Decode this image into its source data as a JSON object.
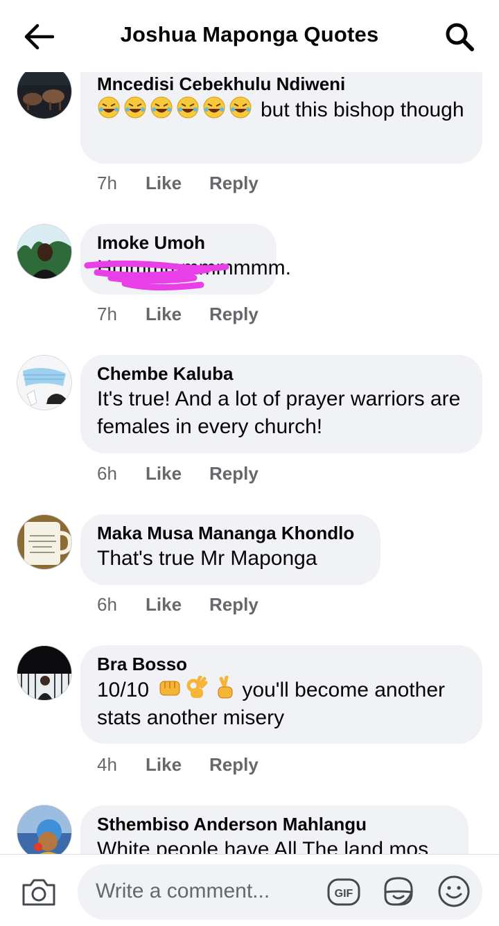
{
  "header": {
    "title": "Joshua Maponga Quotes",
    "back_icon": "arrow-left-icon",
    "search_icon": "search-icon"
  },
  "comments": [
    {
      "author": "Mncedisi Cebekhulu Ndiweni",
      "text": "but this bishop though",
      "emoji": "rolling-on-floor-laughing x6",
      "time": "7h",
      "like": "Like",
      "reply": "Reply"
    },
    {
      "author": "Imoke Umoh",
      "text": "Hmmmmmmmmmm.",
      "time": "7h",
      "like": "Like",
      "reply": "Reply"
    },
    {
      "author": "Chembe Kaluba",
      "text": "It's true! And a lot of prayer warriors are females in every church!",
      "time": "6h",
      "like": "Like",
      "reply": "Reply"
    },
    {
      "author": "Maka Musa Mananga Khondlo",
      "text": "That's true Mr Maponga",
      "time": "6h",
      "like": "Like",
      "reply": "Reply"
    },
    {
      "author": "Bra Bosso",
      "text_prefix": "10/10",
      "text_rest": "you'll become another stats another misery",
      "emoji": "fist, ok-hand, crossed-fingers",
      "time": "4h",
      "like": "Like",
      "reply": "Reply"
    },
    {
      "author": "Sthembiso Anderson Mahlangu",
      "text": "White people have All The land mos"
    }
  ],
  "composer": {
    "placeholder": "Write a comment...",
    "gif_label": "GIF",
    "camera_icon": "camera-icon",
    "sticker_icon": "sticker-icon",
    "emoji_icon": "smiley-icon"
  },
  "colors": {
    "bubble_bg": "#f0f2f5",
    "meta_text": "#65676b",
    "scribble": "#e83fe8"
  }
}
